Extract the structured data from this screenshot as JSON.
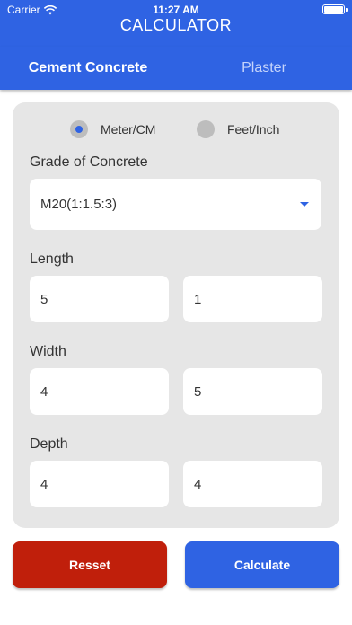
{
  "status_bar": {
    "carrier": "Carrier",
    "time": "11:27 AM"
  },
  "app": {
    "title": "CALCULATOR"
  },
  "tabs": [
    {
      "label": "Cement Concrete",
      "active": true
    },
    {
      "label": "Plaster",
      "active": false
    }
  ],
  "units": {
    "options": [
      {
        "label": "Meter/CM",
        "selected": true
      },
      {
        "label": "Feet/Inch",
        "selected": false
      }
    ]
  },
  "grade": {
    "label": "Grade of Concrete",
    "selected": "M20(1:1.5:3)"
  },
  "length": {
    "label": "Length",
    "major": "5",
    "minor": "1"
  },
  "width": {
    "label": "Width",
    "major": "4",
    "minor": "5"
  },
  "depth": {
    "label": "Depth",
    "major": "4",
    "minor": "4"
  },
  "actions": {
    "reset_label": "Resset",
    "calculate_label": "Calculate"
  },
  "colors": {
    "primary": "#2f63e3",
    "danger": "#c01f0b",
    "card": "#e6e6e6"
  },
  "icons": {
    "wifi": "wifi-icon",
    "battery": "battery-icon",
    "dropdown": "caret-down-icon"
  }
}
